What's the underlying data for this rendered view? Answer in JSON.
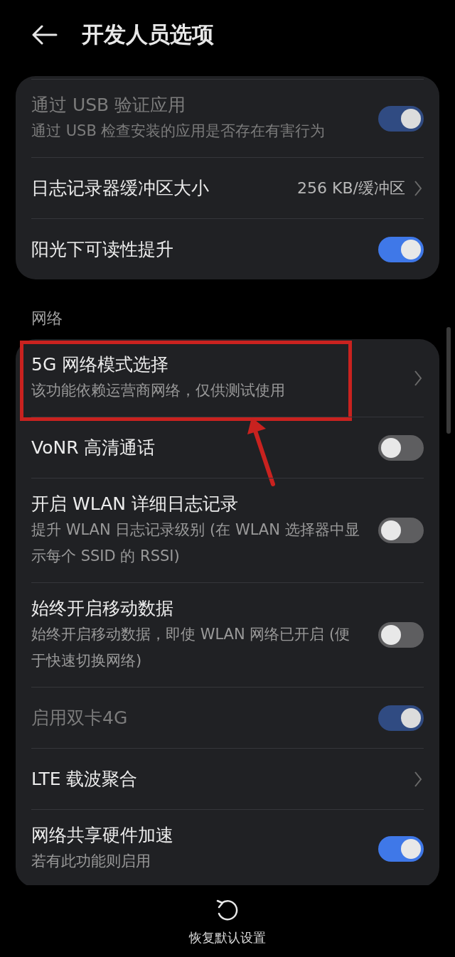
{
  "header": {
    "title": "开发人员选项"
  },
  "sections": [
    {
      "items": [
        {
          "kind": "toggle",
          "title": "通过 USB 验证应用",
          "subtitle": "通过 USB 检查安装的应用是否存在有害行为",
          "on": true,
          "disabled": true,
          "highlighted": false
        },
        {
          "kind": "link",
          "title": "日志记录器缓冲区大小",
          "value": "256 KB/缓冲区",
          "disabled": false,
          "highlighted": false
        },
        {
          "kind": "toggle",
          "title": "阳光下可读性提升",
          "on": true,
          "disabled": false,
          "highlighted": false
        }
      ]
    },
    {
      "label": "网络",
      "items": [
        {
          "kind": "link",
          "title": "5G 网络模式选择",
          "subtitle": "该功能依赖运营商网络，仅供测试使用",
          "disabled": false,
          "highlighted": true
        },
        {
          "kind": "toggle",
          "title": "VoNR 高清通话",
          "on": false,
          "disabled": false,
          "highlighted": false
        },
        {
          "kind": "toggle",
          "title": "开启 WLAN 详细日志记录",
          "subtitle": "提升 WLAN 日志记录级别 (在 WLAN 选择器中显示每个 SSID 的 RSSI)",
          "on": false,
          "disabled": false,
          "highlighted": false
        },
        {
          "kind": "toggle",
          "title": "始终开启移动数据",
          "subtitle": "始终开启移动数据，即使 WLAN 网络已开启 (便于快速切换网络)",
          "on": false,
          "disabled": false,
          "highlighted": false
        },
        {
          "kind": "toggle",
          "title": "启用双卡4G",
          "on": true,
          "disabled": true,
          "highlighted": false
        },
        {
          "kind": "link",
          "title": "LTE 载波聚合",
          "disabled": false,
          "highlighted": false
        },
        {
          "kind": "toggle",
          "title": "网络共享硬件加速",
          "subtitle": "若有此功能则启用",
          "on": true,
          "disabled": false,
          "highlighted": false
        }
      ]
    }
  ],
  "footer": {
    "label": "恢复默认设置"
  }
}
